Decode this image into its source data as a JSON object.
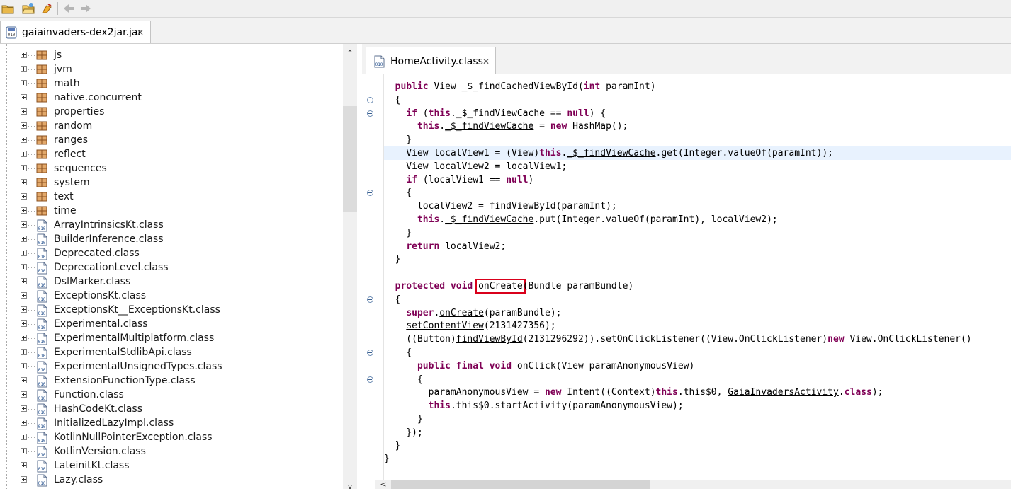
{
  "toolbar": {
    "buttons": [
      {
        "name": "open-file-icon"
      },
      {
        "name": "open-folder-icon"
      },
      {
        "name": "run-icon"
      },
      {
        "name": "back-arrow-icon"
      },
      {
        "name": "forward-arrow-icon"
      }
    ]
  },
  "file_tab": {
    "label": "gaiainvaders-dex2jar.jar",
    "icon": "jar-file-icon"
  },
  "tree": {
    "items": [
      {
        "label": "js",
        "type": "package"
      },
      {
        "label": "jvm",
        "type": "package"
      },
      {
        "label": "math",
        "type": "package"
      },
      {
        "label": "native.concurrent",
        "type": "package"
      },
      {
        "label": "properties",
        "type": "package"
      },
      {
        "label": "random",
        "type": "package"
      },
      {
        "label": "ranges",
        "type": "package"
      },
      {
        "label": "reflect",
        "type": "package"
      },
      {
        "label": "sequences",
        "type": "package"
      },
      {
        "label": "system",
        "type": "package"
      },
      {
        "label": "text",
        "type": "package"
      },
      {
        "label": "time",
        "type": "package"
      },
      {
        "label": "ArrayIntrinsicsKt.class",
        "type": "class"
      },
      {
        "label": "BuilderInference.class",
        "type": "class"
      },
      {
        "label": "Deprecated.class",
        "type": "class"
      },
      {
        "label": "DeprecationLevel.class",
        "type": "class"
      },
      {
        "label": "DslMarker.class",
        "type": "class"
      },
      {
        "label": "ExceptionsKt.class",
        "type": "class"
      },
      {
        "label": "ExceptionsKt__ExceptionsKt.class",
        "type": "class"
      },
      {
        "label": "Experimental.class",
        "type": "class"
      },
      {
        "label": "ExperimentalMultiplatform.class",
        "type": "class"
      },
      {
        "label": "ExperimentalStdlibApi.class",
        "type": "class"
      },
      {
        "label": "ExperimentalUnsignedTypes.class",
        "type": "class"
      },
      {
        "label": "ExtensionFunctionType.class",
        "type": "class"
      },
      {
        "label": "Function.class",
        "type": "class"
      },
      {
        "label": "HashCodeKt.class",
        "type": "class"
      },
      {
        "label": "InitializedLazyImpl.class",
        "type": "class"
      },
      {
        "label": "KotlinNullPointerException.class",
        "type": "class"
      },
      {
        "label": "KotlinVersion.class",
        "type": "class"
      },
      {
        "label": "LateinitKt.class",
        "type": "class"
      },
      {
        "label": "Lazy.class",
        "type": "class"
      }
    ]
  },
  "editor": {
    "tab_label": "HomeActivity.class",
    "tab_icon": "class-file-icon",
    "highlight_color": "#d9001b",
    "keyword_color": "#7f0055",
    "lines": [
      [
        [
          "  ",
          ""
        ],
        [
          "public",
          "kw"
        ],
        [
          " View _$_findCachedViewById(",
          ""
        ],
        [
          "int",
          "kw"
        ],
        [
          " paramInt)",
          ""
        ]
      ],
      [
        [
          "  {",
          ""
        ]
      ],
      [
        [
          "    ",
          ""
        ],
        [
          "if",
          "kw"
        ],
        [
          " (",
          ""
        ],
        [
          "this",
          "kw"
        ],
        [
          ".",
          ""
        ],
        [
          "_$_findViewCache",
          "ul"
        ],
        [
          " == ",
          ""
        ],
        [
          "null",
          "kw"
        ],
        [
          ") {",
          ""
        ]
      ],
      [
        [
          "      ",
          ""
        ],
        [
          "this",
          "kw"
        ],
        [
          ".",
          ""
        ],
        [
          "_$_findViewCache",
          "ul"
        ],
        [
          " = ",
          ""
        ],
        [
          "new",
          "kw"
        ],
        [
          " HashMap();",
          ""
        ]
      ],
      [
        [
          "    }",
          ""
        ]
      ],
      [
        [
          "    View localView1 = (View)",
          ""
        ],
        [
          "this",
          "kw"
        ],
        [
          ".",
          ""
        ],
        [
          "_$_findViewCache",
          "ul"
        ],
        [
          ".get(Integer.valueOf(paramInt));",
          ""
        ]
      ],
      [
        [
          "    View localView2 = localView1;",
          ""
        ]
      ],
      [
        [
          "    ",
          ""
        ],
        [
          "if",
          "kw"
        ],
        [
          " (localView1 == ",
          ""
        ],
        [
          "null",
          "kw"
        ],
        [
          ")",
          ""
        ]
      ],
      [
        [
          "    {",
          ""
        ]
      ],
      [
        [
          "      localView2 = findViewById(paramInt);",
          ""
        ]
      ],
      [
        [
          "      ",
          ""
        ],
        [
          "this",
          "kw"
        ],
        [
          ".",
          ""
        ],
        [
          "_$_findViewCache",
          "ul"
        ],
        [
          ".put(Integer.valueOf(paramInt), localView2);",
          ""
        ]
      ],
      [
        [
          "    }",
          ""
        ]
      ],
      [
        [
          "    ",
          ""
        ],
        [
          "return",
          "kw"
        ],
        [
          " localView2;",
          ""
        ]
      ],
      [
        [
          "  }",
          ""
        ]
      ],
      [
        [
          "",
          ""
        ]
      ],
      [
        [
          "  ",
          ""
        ],
        [
          "protected",
          "kw"
        ],
        [
          " ",
          ""
        ],
        [
          "void",
          "kw"
        ],
        [
          " ",
          ""
        ],
        [
          "onCreate",
          "hl"
        ],
        [
          "(Bundle paramBundle)",
          ""
        ]
      ],
      [
        [
          "  {",
          ""
        ]
      ],
      [
        [
          "    ",
          ""
        ],
        [
          "super",
          "kw"
        ],
        [
          ".",
          ""
        ],
        [
          "onCreate",
          "ul"
        ],
        [
          "(paramBundle);",
          ""
        ]
      ],
      [
        [
          "    ",
          ""
        ],
        [
          "setContentView",
          "ul"
        ],
        [
          "(2131427356);",
          ""
        ]
      ],
      [
        [
          "    ((Button)",
          ""
        ],
        [
          "findViewById",
          "ul"
        ],
        [
          "(2131296292)).setOnClickListener((View.OnClickListener)",
          ""
        ],
        [
          "new",
          "kw"
        ],
        [
          " View.OnClickListener()",
          ""
        ]
      ],
      [
        [
          "    {",
          ""
        ]
      ],
      [
        [
          "      ",
          ""
        ],
        [
          "public",
          "kw"
        ],
        [
          " ",
          ""
        ],
        [
          "final",
          "kw"
        ],
        [
          " ",
          ""
        ],
        [
          "void",
          "kw"
        ],
        [
          " onClick(View paramAnonymousView)",
          ""
        ]
      ],
      [
        [
          "      {",
          ""
        ]
      ],
      [
        [
          "        paramAnonymousView = ",
          ""
        ],
        [
          "new",
          "kw"
        ],
        [
          " Intent((Context)",
          ""
        ],
        [
          "this",
          "kw"
        ],
        [
          ".this$0, ",
          ""
        ],
        [
          "GaiaInvadersActivity",
          "ul"
        ],
        [
          ".",
          ""
        ],
        [
          "class",
          "kw"
        ],
        [
          ");",
          ""
        ]
      ],
      [
        [
          "        ",
          ""
        ],
        [
          "this",
          "kw"
        ],
        [
          ".this$0.startActivity(paramAnonymousView);",
          ""
        ]
      ],
      [
        [
          "      }",
          ""
        ]
      ],
      [
        [
          "    });",
          ""
        ]
      ],
      [
        [
          "  }",
          ""
        ]
      ],
      [
        [
          "}",
          ""
        ]
      ]
    ]
  }
}
